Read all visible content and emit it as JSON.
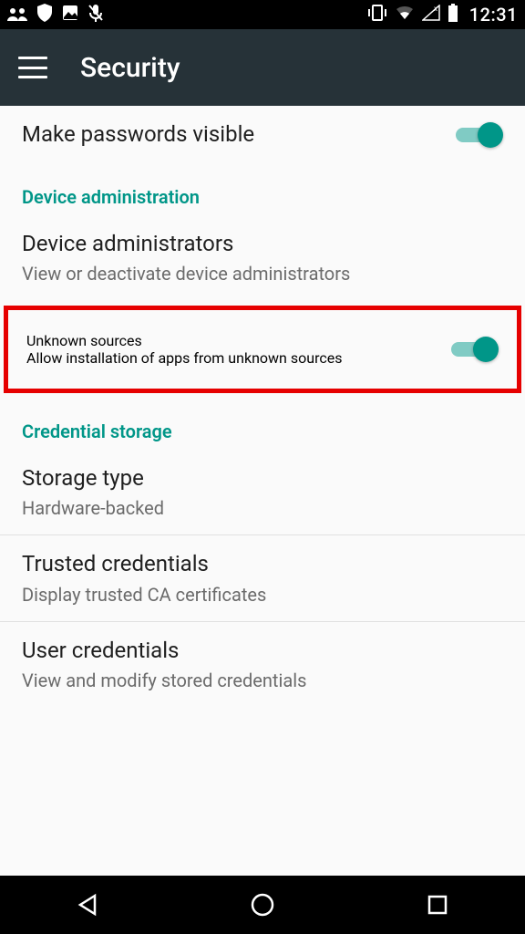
{
  "statusbar": {
    "time": "12:31"
  },
  "appbar": {
    "title": "Security"
  },
  "items": {
    "passwords": {
      "title": "Make passwords visible"
    },
    "section_device_admin": "Device administration",
    "device_admins": {
      "title": "Device administrators",
      "subtitle": "View or deactivate device administrators"
    },
    "unknown_sources": {
      "title": "Unknown sources",
      "subtitle": "Allow installation of apps from unknown sources"
    },
    "section_credential": "Credential storage",
    "storage_type": {
      "title": "Storage type",
      "subtitle": "Hardware-backed"
    },
    "trusted_creds": {
      "title": "Trusted credentials",
      "subtitle": "Display trusted CA certificates"
    },
    "user_creds": {
      "title": "User credentials",
      "subtitle": "View and modify stored credentials"
    }
  }
}
